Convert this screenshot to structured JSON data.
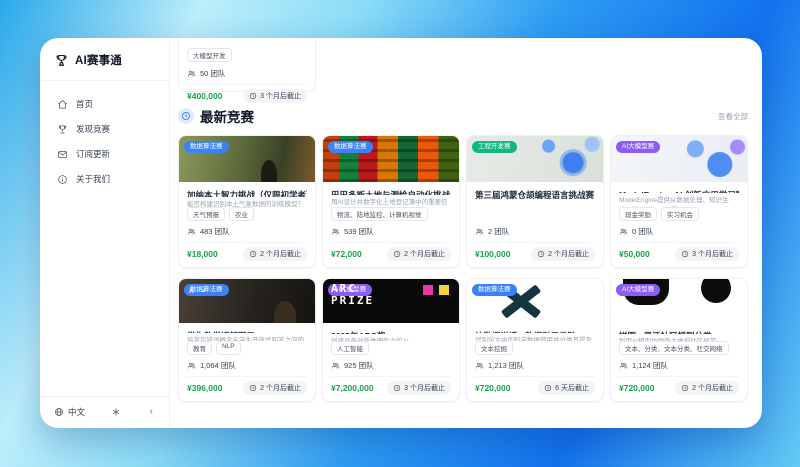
{
  "app": {
    "title": "AI赛事通"
  },
  "colors": {
    "accent": "#2563eb",
    "prize_green": "#16a34a",
    "background_blue": "#1272ee",
    "badges": {
      "data": "#3b82f6",
      "engineering": "#10b981",
      "ai_model": "#8b5cf6"
    }
  },
  "sidebar": {
    "items": [
      {
        "label": "首页",
        "icon": "home-icon"
      },
      {
        "label": "发现竞赛",
        "icon": "trophy-icon"
      },
      {
        "label": "订阅更新",
        "icon": "mail-icon"
      },
      {
        "label": "关于我们",
        "icon": "info-icon"
      }
    ],
    "footer": {
      "language": "中文"
    }
  },
  "main": {
    "partial_card": {
      "tag": "大模型开发",
      "teams": "50 团队",
      "prize": "¥400,000",
      "deadline": "3 个月后截止"
    },
    "section": {
      "title": "最新竞赛",
      "view_all": "查看全部"
    },
    "cards": [
      {
        "badge": "数据算法赛",
        "badge_type": "data",
        "image": "ghana",
        "image_text": "",
        "title": "加纳本土智力挑战（仅限初学者）",
        "desc": "能否构建识别本土气象数据的训练模型？",
        "tags": [
          "天气预报",
          "农业"
        ],
        "teams": "483 团队",
        "prize": "¥18,000",
        "deadline": "2 个月后截止"
      },
      {
        "badge": "数据算法赛",
        "badge_type": "data",
        "image": "map",
        "image_text": "",
        "title": "巴巴多斯土地与测绘自动化挑战",
        "desc": "用AI设计并数字化土地登记簿中的重要信息吗？",
        "tags": [
          "物流、陆地监控、计算机视觉"
        ],
        "teams": "539 团队",
        "prize": "¥72,000",
        "deadline": "2 个月后截止"
      },
      {
        "badge": "工程开发赛",
        "badge_type": "engineering",
        "image": "harmony",
        "image_text": "",
        "title": "第三届鸿蒙仓颉编程语言挑战赛",
        "desc": "",
        "tags": [],
        "teams": "2 团队",
        "prize": "¥100,000",
        "deadline": "2 个月后截止"
      },
      {
        "badge": "AI大模型赛",
        "badge_type": "ai_model",
        "image": "modelengine",
        "image_text": "",
        "title": "ModelEngine AI 创新应用学习赛",
        "desc": "ModelEngine提供从数据处理、知识生成、模型微调到部署，以及RAG应用开发的AI训练全流程工具链，本次竞赛鼓励参赛者基于",
        "tags": [
          "现金奖励",
          "实习机会"
        ],
        "teams": "0 团队",
        "prize": "¥50,000",
        "deadline": "3 个月后截止"
      },
      {
        "badge": "数据算法赛",
        "badge_type": "data",
        "image": "math",
        "image_text": "A =",
        "title": "学生数学误解图示",
        "desc": "将常见错误概念与学生开放式回答之间的关联",
        "tags": [
          "教育",
          "NLP"
        ],
        "teams": "1,064 团队",
        "prize": "¥396,000",
        "deadline": "2 个月后截止"
      },
      {
        "badge": "AI大模型赛",
        "badge_type": "ai_model",
        "image": "arc",
        "image_text": "ARC\nPRIZE",
        "title": "2025年ARC奖",
        "desc": "创建具备创新推理能力的AI",
        "tags": [
          "人工智能"
        ],
        "teams": "925 团队",
        "prize": "¥7,200,000",
        "deadline": "3 个月后截止"
      },
      {
        "badge": "数据算法赛",
        "badge_type": "data",
        "image": "xlogo",
        "image_text": "",
        "title": "让数据说话 · 数据引用寻踪",
        "desc": "识别论文中的科学数据使用并分类其提及方式。",
        "tags": [
          "文本挖掘"
        ],
        "teams": "1,213 团队",
        "prize": "¥720,000",
        "deadline": "6 天后截止"
      },
      {
        "badge": "AI大模型赛",
        "badge_type": "ai_model",
        "image": "jigsaw",
        "image_text": "",
        "title": "拼图 · 灵活社区规则分类",
        "desc": "利用AI模型协助版主维护社区规范。",
        "tags": [
          "文本、分类、文本分类、社交网络"
        ],
        "teams": "1,124 团队",
        "prize": "¥720,000",
        "deadline": "2 个月后截止"
      }
    ]
  }
}
